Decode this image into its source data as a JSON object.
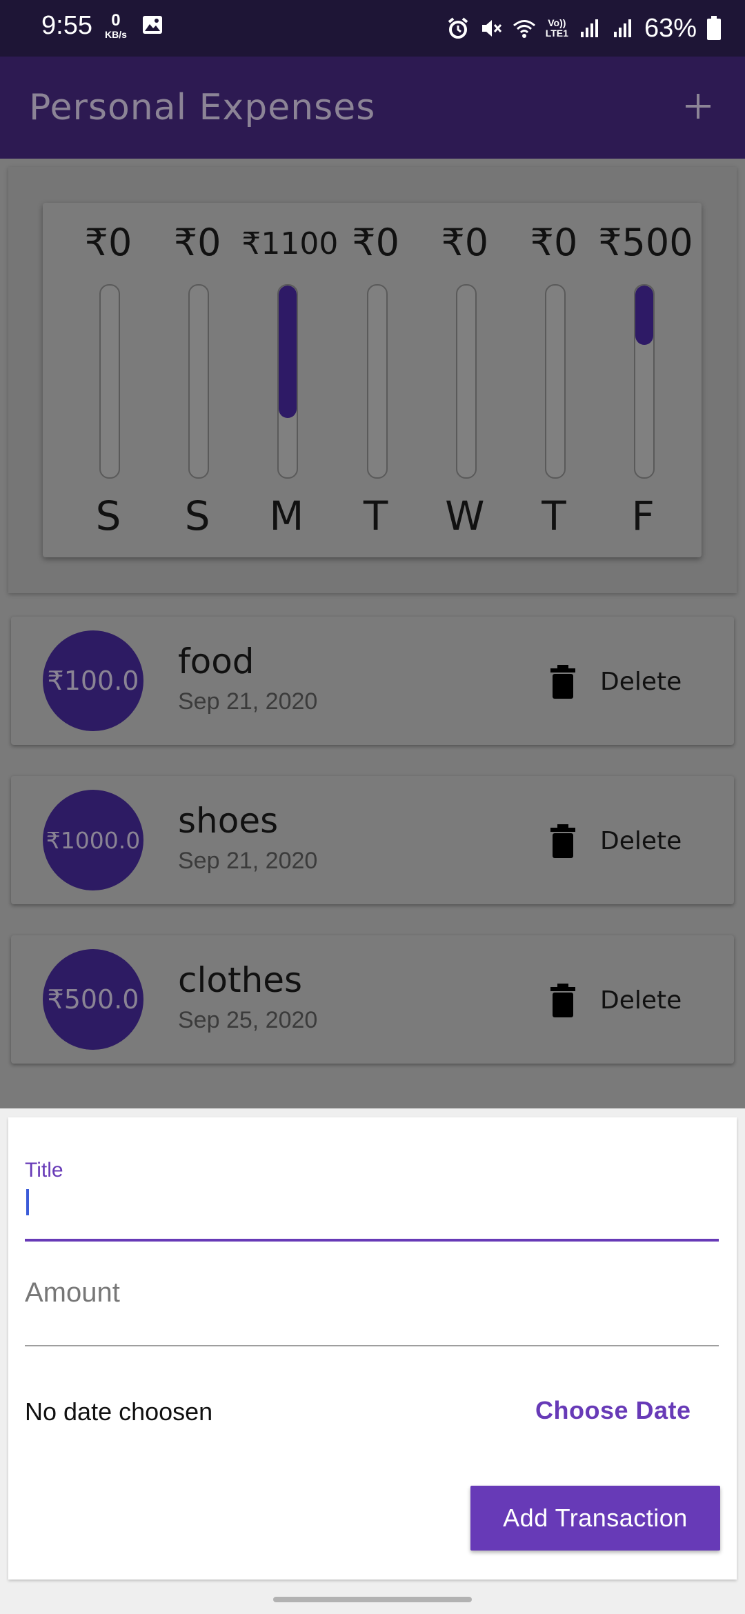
{
  "status_bar": {
    "time": "9:55",
    "net_speed_value": "0",
    "net_speed_unit": "KB/s",
    "lte_top": "Vo))",
    "lte_bottom": "LTE1",
    "battery": "63%"
  },
  "app_bar": {
    "title": "Personal Expenses",
    "add_icon": "plus-icon"
  },
  "chart_data": {
    "type": "bar",
    "categories": [
      "S",
      "S",
      "M",
      "T",
      "W",
      "T",
      "F"
    ],
    "amount_labels": [
      "₹0",
      "₹0",
      "₹1100",
      "₹0",
      "₹0",
      "₹0",
      "₹500"
    ],
    "fill_fractions": [
      0,
      0,
      0.69,
      0,
      0,
      0,
      0.31
    ]
  },
  "transactions": [
    {
      "amount": "₹100.0",
      "title": "food",
      "date": "Sep 21, 2020",
      "delete_label": "Delete"
    },
    {
      "amount": "₹1000.0",
      "title": "shoes",
      "date": "Sep 21, 2020",
      "delete_label": "Delete"
    },
    {
      "amount": "₹500.0",
      "title": "clothes",
      "date": "Sep 25, 2020",
      "delete_label": "Delete"
    }
  ],
  "form": {
    "title_label": "Title",
    "amount_placeholder": "Amount",
    "date_status": "No date choosen",
    "choose_date_label": "Choose Date",
    "submit_label": "Add Transaction"
  },
  "colors": {
    "primary": "#673ab7",
    "status_bar": "#1e1536",
    "app_bar": "#2d1a52",
    "bar_fill": "#2e1a66",
    "scrim": "#7a7a7a"
  }
}
